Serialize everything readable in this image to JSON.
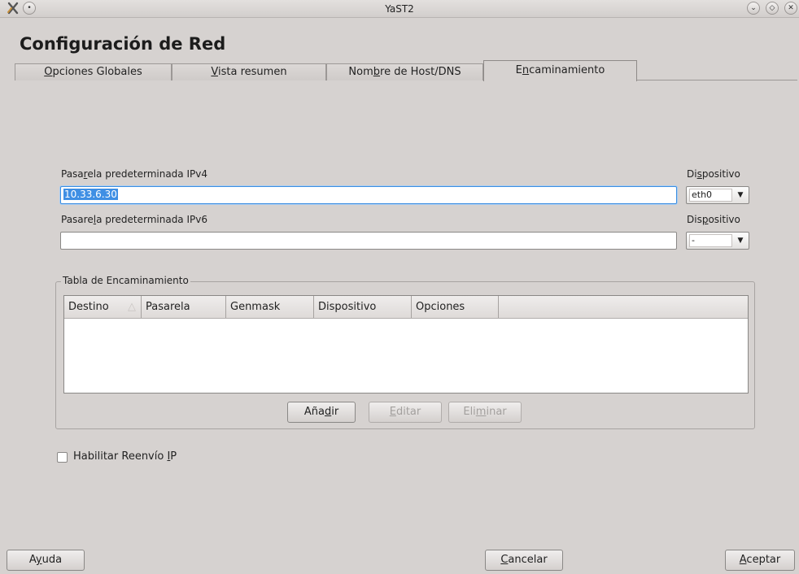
{
  "window": {
    "title": "YaST2"
  },
  "heading": "Configuración de Red",
  "tabs": [
    {
      "pre": "",
      "key": "O",
      "post": "pciones Globales"
    },
    {
      "pre": "",
      "key": "V",
      "post": "ista resumen"
    },
    {
      "pre": "Nom",
      "key": "b",
      "post": "re de Host/DNS"
    },
    {
      "pre": "E",
      "key": "n",
      "post": "caminamiento"
    }
  ],
  "ipv4": {
    "label_pre": "Pasa",
    "label_key": "r",
    "label_post": "ela predeterminada IPv4",
    "value": "10.33.6.30",
    "device_label_pre": "Di",
    "device_label_key": "s",
    "device_label_post": "positivo",
    "device_value": "eth0"
  },
  "ipv6": {
    "label_pre": "Pasare",
    "label_key": "l",
    "label_post": "a predeterminada IPv6",
    "value": "",
    "device_label_pre": "Dis",
    "device_label_key": "p",
    "device_label_post": "ositivo",
    "device_value": "-"
  },
  "routing_table": {
    "title": "Tabla de Encaminamiento",
    "columns": [
      "Destino",
      "Pasarela",
      "Genmask",
      "Dispositivo",
      "Opciones"
    ],
    "rows": []
  },
  "table_buttons": {
    "add": {
      "pre": "Aña",
      "key": "d",
      "post": "ir"
    },
    "edit": {
      "pre": "",
      "key": "E",
      "post": "ditar"
    },
    "delete": {
      "pre": "Eli",
      "key": "m",
      "post": "inar"
    }
  },
  "ip_forwarding": {
    "pre": "Habilitar Reenvío ",
    "key": "I",
    "post": "P",
    "checked": false
  },
  "footer": {
    "help": {
      "pre": "A",
      "key": "y",
      "post": "uda"
    },
    "cancel": {
      "pre": "",
      "key": "C",
      "post": "ancelar"
    },
    "accept": {
      "pre": "",
      "key": "A",
      "post": "ceptar"
    }
  }
}
